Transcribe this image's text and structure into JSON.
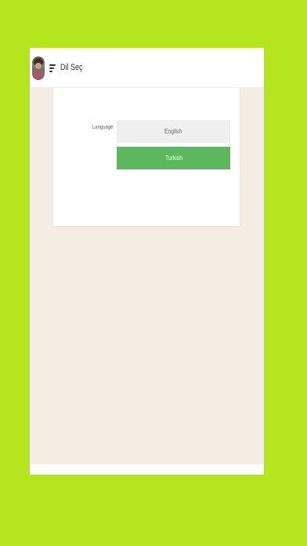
{
  "header": {
    "title": "Dil Seç",
    "avatar_icon": "user-avatar",
    "menu_icon": "menu-icon"
  },
  "language_form": {
    "label": "Language",
    "options": [
      {
        "label": "English",
        "selected": false
      },
      {
        "label": "Turkish",
        "selected": true
      }
    ]
  },
  "colors": {
    "frame_background": "#b5e61d",
    "content_background": "#f4ede4",
    "selected_option": "#5cb85c",
    "unselected_option": "#efefef"
  }
}
